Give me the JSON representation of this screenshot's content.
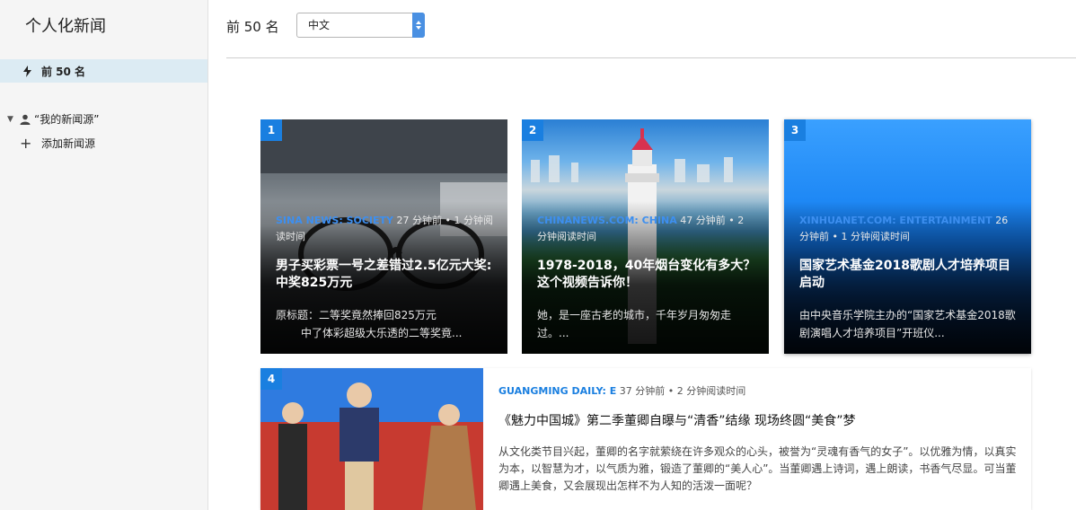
{
  "sidebar": {
    "app_title": "个人化新闻",
    "top_item": "前 50 名",
    "group_label": "“我的新闻源”",
    "add_label": "添加新闻源"
  },
  "topbar": {
    "title": "前 50 名",
    "language_selected": "中文"
  },
  "articles": [
    {
      "rank": "1",
      "source": "SINA NEWS: SOCIETY",
      "meta": "27 分钟前 • 1 分钟阅读时间",
      "headline": "男子买彩票一号之差错过2.5亿元大奖:中奖825万元",
      "snippet_line1": "原标题：二等奖竟然捧回825万元",
      "snippet_line2": "中了体彩超级大乐透的二等奖竟..."
    },
    {
      "rank": "2",
      "source": "CHINANEWS.COM: CHINA",
      "meta": "47 分钟前 • 2 分钟阅读时间",
      "headline": "1978-2018，40年烟台变化有多大？这个视频告诉你！",
      "snippet_line1": "她，是一座古老的城市，千年岁月匆匆走过。..."
    },
    {
      "rank": "3",
      "source": "XINHUANET.COM: ENTERTAINMENT",
      "meta": "26 分钟前 • 1 分钟阅读时间",
      "headline": "国家艺术基金2018歌剧人才培养项目启动",
      "snippet_line1": "由中央音乐学院主办的“国家艺术基金2018歌剧演唱人才培养项目”开班仪..."
    },
    {
      "rank": "4",
      "source": "GUANGMING DAILY: E",
      "meta": "37 分钟前 • 2 分钟阅读时间",
      "headline": "《魅力中国城》第二季董卿自曝与“清香”结缘 现场终圆“美食”梦",
      "snippet_line1": "从文化类节目兴起，董卿的名字就萦绕在许多观众的心头，被誉为“灵魂有香气的女子”。以优雅为情，以真实为本，以智慧为才，以气质为雅，锻造了董卿的“美人心”。当董卿遇上诗词，遇上朗读，书香气尽显。可当董卿遇上美食，又会展现出怎样不为人知的活泼一面呢？"
    }
  ],
  "colors": {
    "accent": "#1a7fe0",
    "sidebar_bg": "#f5f5f5",
    "selected_bg": "#dcebf3"
  },
  "icons": {
    "top_item": "lightning-bolt-icon",
    "group": "person-icon",
    "group_toggle": "triangle-down-icon",
    "add": "plus-icon",
    "select": "select-arrows-icon"
  }
}
